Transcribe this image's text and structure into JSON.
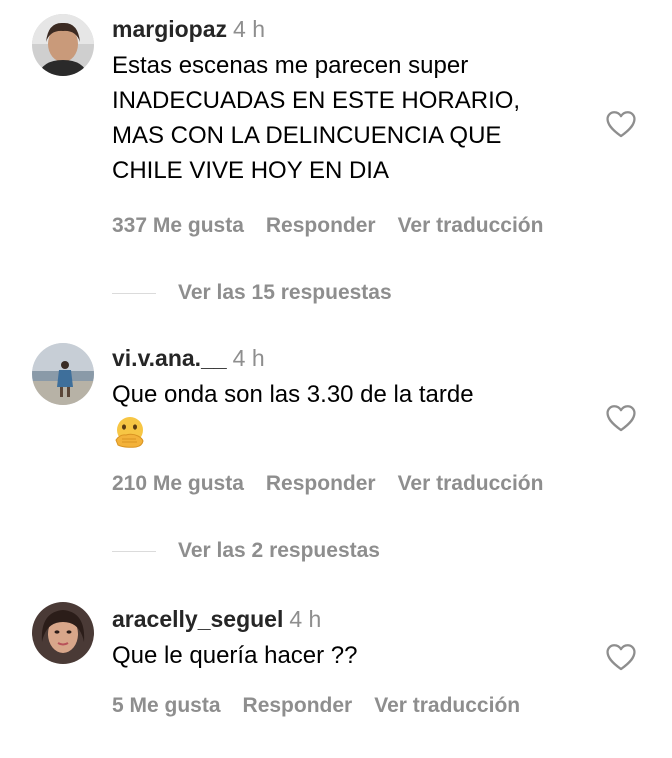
{
  "comments": [
    {
      "username": "margiopaz",
      "time": "4 h",
      "lines": [
        "Estas escenas me parecen super",
        "INADECUADAS EN ESTE HORARIO,",
        "MAS CON LA DELINCUENCIA QUE",
        "CHILE VIVE HOY EN DIA"
      ],
      "likes": "337 Me gusta",
      "reply": "Responder",
      "translate": "Ver traducción",
      "view_replies": "Ver las 15 respuestas"
    },
    {
      "username": "vi.v.ana.__",
      "time": "4 h",
      "lines": [
        "Que onda son las 3.30 de la tarde"
      ],
      "emoji": "face-with-hand-over-mouth-emoji",
      "likes": "210 Me gusta",
      "reply": "Responder",
      "translate": "Ver traducción",
      "view_replies": "Ver las 2 respuestas"
    },
    {
      "username": "aracelly_seguel",
      "time": "4 h",
      "lines": [
        "Que le quería hacer ??"
      ],
      "likes": "5 Me gusta",
      "reply": "Responder",
      "translate": "Ver traducción"
    }
  ],
  "icons": {
    "like": "heart-outline-icon"
  },
  "colors": {
    "secondary_text": "#8e8e8e",
    "primary_text": "#000000",
    "divider": "#dbdbdb"
  }
}
